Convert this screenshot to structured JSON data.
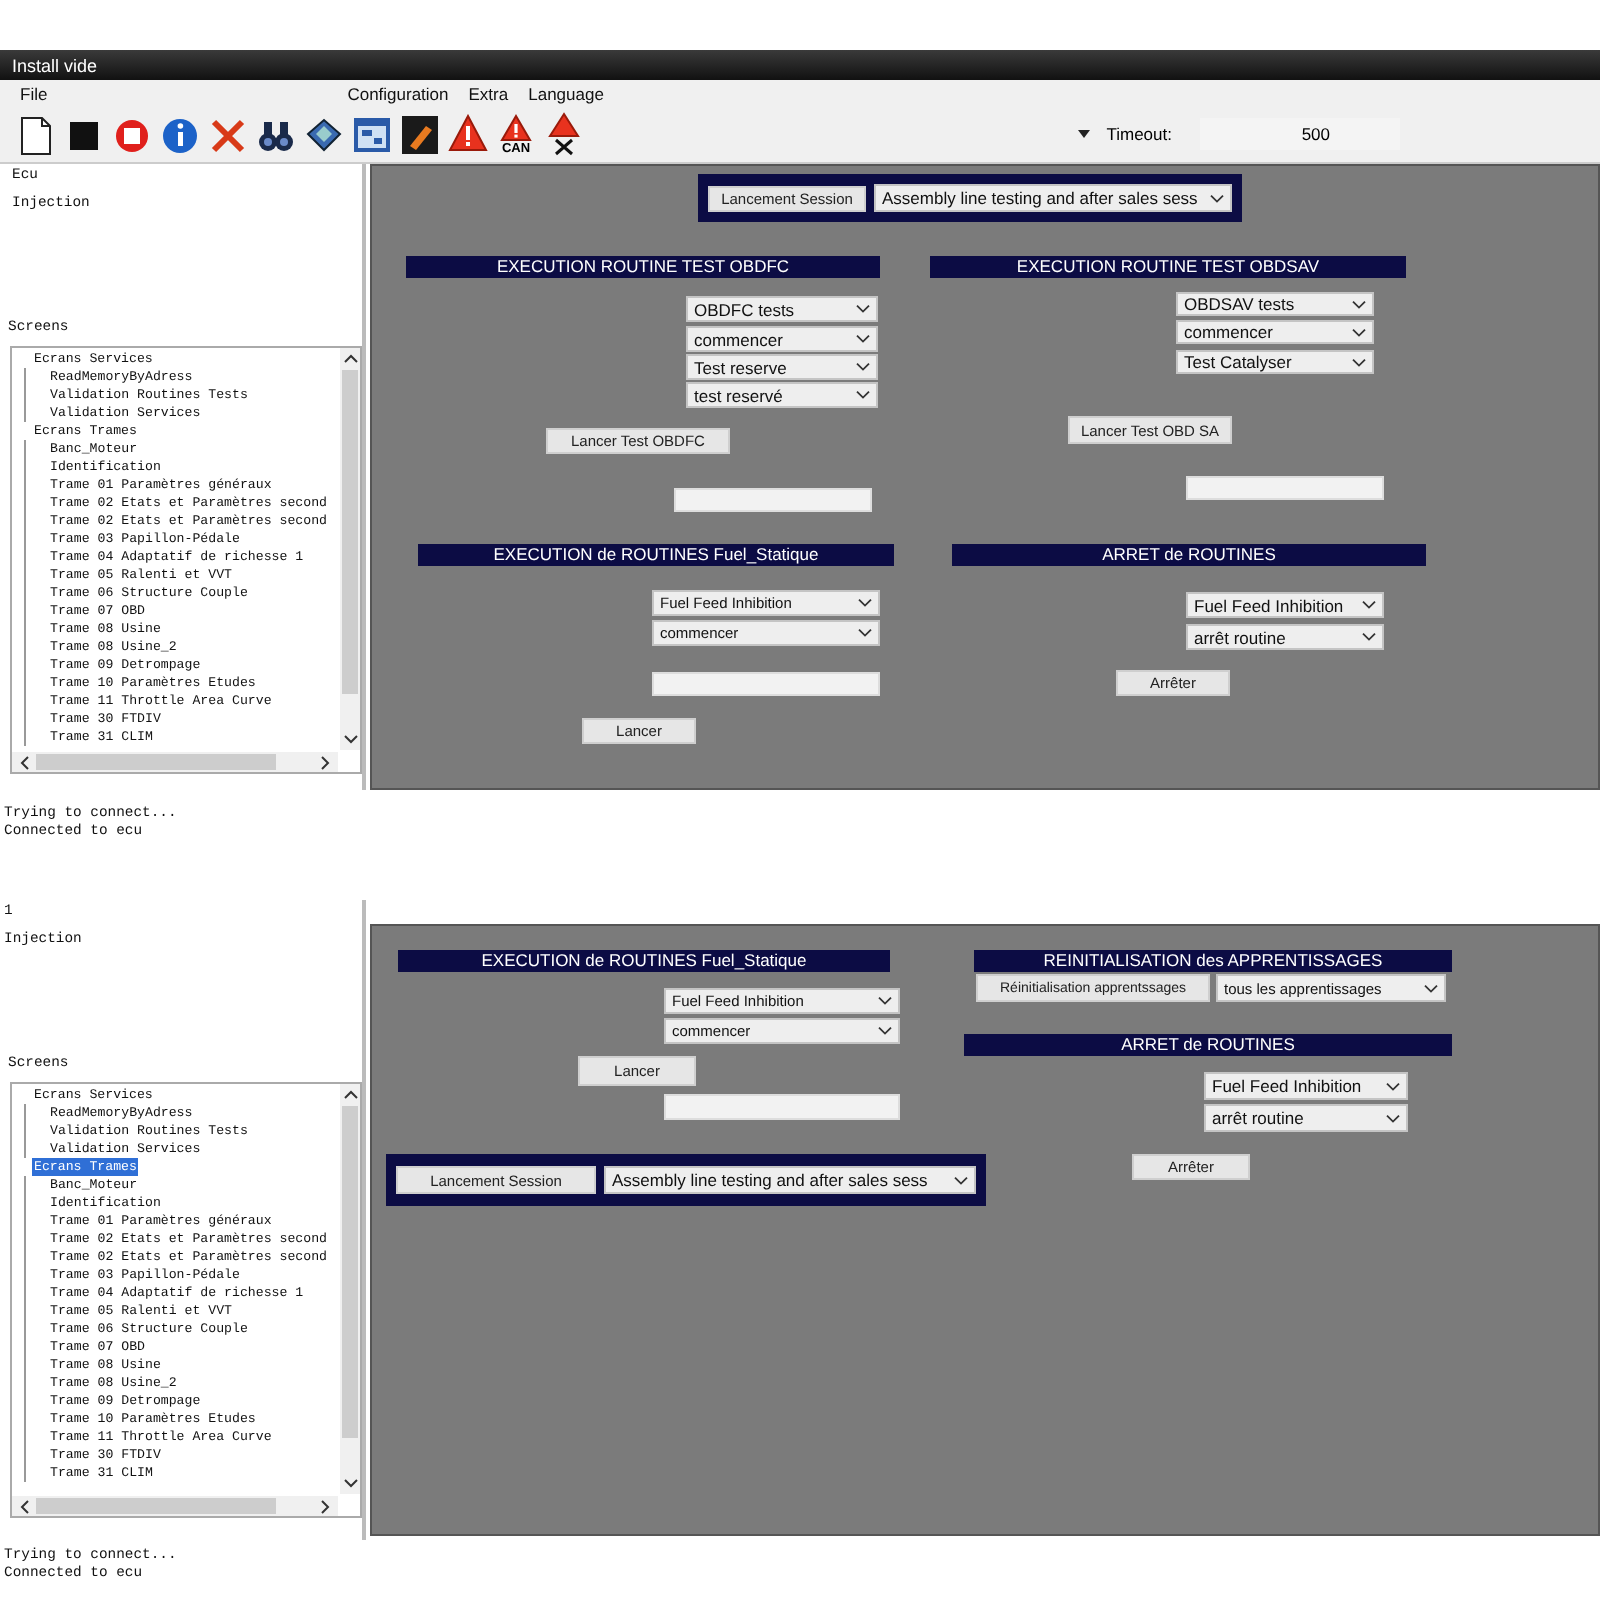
{
  "window": {
    "title": "Install vide"
  },
  "menu": [
    "File",
    "Configuration",
    "Extra",
    "Language"
  ],
  "toolbar": {
    "can_label": "CAN",
    "timeout_label": "Timeout:",
    "timeout_value": "500"
  },
  "views": [
    {
      "ecu_info": [
        "Ecu",
        "Injection"
      ],
      "screens_label": "Screens",
      "tree": [
        {
          "label": "Ecrans Services",
          "selected": false,
          "children": [
            {
              "label": "ReadMemoryByAdress",
              "selected": false
            },
            {
              "label": "Validation Routines Tests",
              "selected": false
            },
            {
              "label": "Validation Services",
              "selected": false
            }
          ]
        },
        {
          "label": "Ecrans Trames",
          "selected": false,
          "children": [
            {
              "label": "Banc_Moteur",
              "selected": false
            },
            {
              "label": "Identification",
              "selected": false
            },
            {
              "label": "Trame 01 Paramètres généraux",
              "selected": false
            },
            {
              "label": "Trame 02 Etats et Paramètres second",
              "selected": false
            },
            {
              "label": "Trame 02 Etats et Paramètres second",
              "selected": false
            },
            {
              "label": "Trame 03 Papillon-Pédale",
              "selected": false
            },
            {
              "label": "Trame 04 Adaptatif de richesse 1",
              "selected": false
            },
            {
              "label": "Trame 05 Ralenti et VVT",
              "selected": false
            },
            {
              "label": "Trame 06 Structure Couple",
              "selected": false
            },
            {
              "label": "Trame 07 OBD",
              "selected": false
            },
            {
              "label": "Trame 08 Usine",
              "selected": false
            },
            {
              "label": "Trame 08 Usine_2",
              "selected": false
            },
            {
              "label": "Trame 09 Detrompage",
              "selected": false
            },
            {
              "label": "Trame 10 Paramètres Etudes",
              "selected": false
            },
            {
              "label": "Trame 11 Throttle Area Curve",
              "selected": false
            },
            {
              "label": "Trame 30 FTDIV",
              "selected": false
            },
            {
              "label": "Trame 31 CLIM",
              "selected": false
            }
          ]
        }
      ],
      "panel": [
        {
          "kind": "session",
          "button": "Lancement Session",
          "value": "Assembly line testing and after sales sess"
        },
        {
          "kind": "header",
          "text": "EXECUTION ROUTINE TEST OBDFC"
        },
        {
          "kind": "select",
          "value": "OBDFC tests"
        },
        {
          "kind": "select",
          "value": "commencer"
        },
        {
          "kind": "select",
          "value": "Test reserve"
        },
        {
          "kind": "select",
          "value": "test reservé"
        },
        {
          "kind": "button",
          "text": "Lancer Test OBDFC"
        },
        {
          "kind": "field"
        },
        {
          "kind": "header",
          "text": "EXECUTION ROUTINE TEST OBDSAV"
        },
        {
          "kind": "select",
          "value": "OBDSAV tests"
        },
        {
          "kind": "select",
          "value": "commencer"
        },
        {
          "kind": "select",
          "value": "Test Catalyser"
        },
        {
          "kind": "button",
          "text": "Lancer Test OBD SA"
        },
        {
          "kind": "field"
        },
        {
          "kind": "header",
          "text": "EXECUTION de ROUTINES Fuel_Statique"
        },
        {
          "kind": "select",
          "value": "Fuel Feed Inhibition"
        },
        {
          "kind": "select",
          "value": "commencer"
        },
        {
          "kind": "field"
        },
        {
          "kind": "button",
          "text": "Lancer"
        },
        {
          "kind": "header",
          "text": "ARRET de ROUTINES"
        },
        {
          "kind": "select",
          "value": "Fuel Feed Inhibition"
        },
        {
          "kind": "select",
          "value": "arrêt routine"
        },
        {
          "kind": "button",
          "text": "Arrêter"
        }
      ],
      "log": [
        "Trying to connect...",
        "Connected to ecu"
      ]
    },
    {
      "ecu_info": [
        "1",
        "Injection"
      ],
      "screens_label": "Screens",
      "tree": [
        {
          "label": "Ecrans Services",
          "selected": false,
          "children": [
            {
              "label": "ReadMemoryByAdress",
              "selected": false
            },
            {
              "label": "Validation Routines Tests",
              "selected": false
            },
            {
              "label": "Validation Services",
              "selected": false
            }
          ]
        },
        {
          "label": "Ecrans Trames",
          "selected": true,
          "children": [
            {
              "label": "Banc_Moteur",
              "selected": false
            },
            {
              "label": "Identification",
              "selected": false
            },
            {
              "label": "Trame 01 Paramètres généraux",
              "selected": false
            },
            {
              "label": "Trame 02 Etats et Paramètres second",
              "selected": false
            },
            {
              "label": "Trame 02 Etats et Paramètres second",
              "selected": false
            },
            {
              "label": "Trame 03 Papillon-Pédale",
              "selected": false
            },
            {
              "label": "Trame 04 Adaptatif de richesse 1",
              "selected": false
            },
            {
              "label": "Trame 05 Ralenti et VVT",
              "selected": false
            },
            {
              "label": "Trame 06 Structure Couple",
              "selected": false
            },
            {
              "label": "Trame 07 OBD",
              "selected": false
            },
            {
              "label": "Trame 08 Usine",
              "selected": false
            },
            {
              "label": "Trame 08 Usine_2",
              "selected": false
            },
            {
              "label": "Trame 09 Detrompage",
              "selected": false
            },
            {
              "label": "Trame 10 Paramètres Etudes",
              "selected": false
            },
            {
              "label": "Trame 11 Throttle Area Curve",
              "selected": false
            },
            {
              "label": "Trame 30 FTDIV",
              "selected": false
            },
            {
              "label": "Trame 31 CLIM",
              "selected": false
            }
          ]
        }
      ],
      "panel": [
        {
          "kind": "header",
          "text": "EXECUTION de ROUTINES Fuel_Statique"
        },
        {
          "kind": "select",
          "value": "Fuel Feed Inhibition"
        },
        {
          "kind": "select",
          "value": "commencer"
        },
        {
          "kind": "button",
          "text": "Lancer"
        },
        {
          "kind": "field"
        },
        {
          "kind": "header",
          "text": "REINITIALISATION des APPRENTISSAGES"
        },
        {
          "kind": "button",
          "text": "Réinitialisation apprentssages"
        },
        {
          "kind": "select",
          "value": "tous les apprentissages"
        },
        {
          "kind": "header",
          "text": "ARRET de ROUTINES"
        },
        {
          "kind": "select",
          "value": "Fuel Feed Inhibition"
        },
        {
          "kind": "select",
          "value": "arrêt routine"
        },
        {
          "kind": "button",
          "text": "Arrêter"
        },
        {
          "kind": "session",
          "button": "Lancement Session",
          "value": "Assembly line testing and after sales sess"
        }
      ],
      "log": [
        "Trying to connect...",
        "Connected to ecu"
      ]
    }
  ]
}
